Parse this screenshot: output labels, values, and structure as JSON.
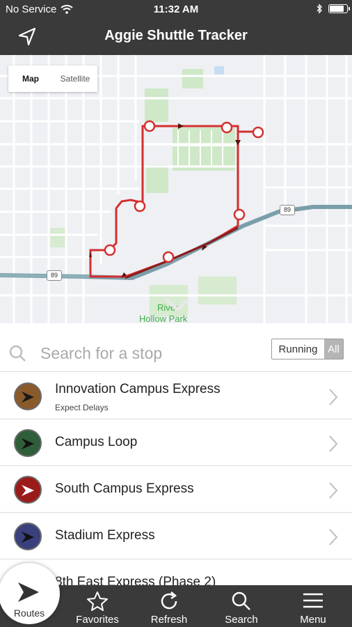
{
  "status": {
    "carrier": "No Service",
    "time": "11:32 AM",
    "battery_level": 0.85
  },
  "header": {
    "title": "Aggie Shuttle Tracker",
    "location_icon": "location-arrow-icon"
  },
  "map": {
    "toggle": {
      "map_label": "Map",
      "satellite_label": "Satellite",
      "selected": "Map"
    },
    "shield_a": "89",
    "shield_b": "89",
    "park_label_1": "River",
    "park_label_2": "Hollow Park",
    "route_color": "#d32f2f"
  },
  "search": {
    "placeholder": "Search for a stop",
    "filter_running": "Running",
    "filter_all": "All"
  },
  "routes": [
    {
      "name": "Innovation Campus Express",
      "subtitle": "Expect Delays",
      "color": "#8a5a2b"
    },
    {
      "name": "Campus Loop",
      "subtitle": "",
      "color": "#2f5e3a"
    },
    {
      "name": "South Campus Express",
      "subtitle": "",
      "color": "#9b1b1b"
    },
    {
      "name": "Stadium Express",
      "subtitle": "",
      "color": "#3a3f7d"
    },
    {
      "name": "8th East Express (Phase 2)",
      "subtitle": "",
      "color": "#555555"
    }
  ],
  "tabs": {
    "routes": "Routes",
    "favorites": "Favorites",
    "refresh": "Refresh",
    "search": "Search",
    "menu": "Menu"
  }
}
